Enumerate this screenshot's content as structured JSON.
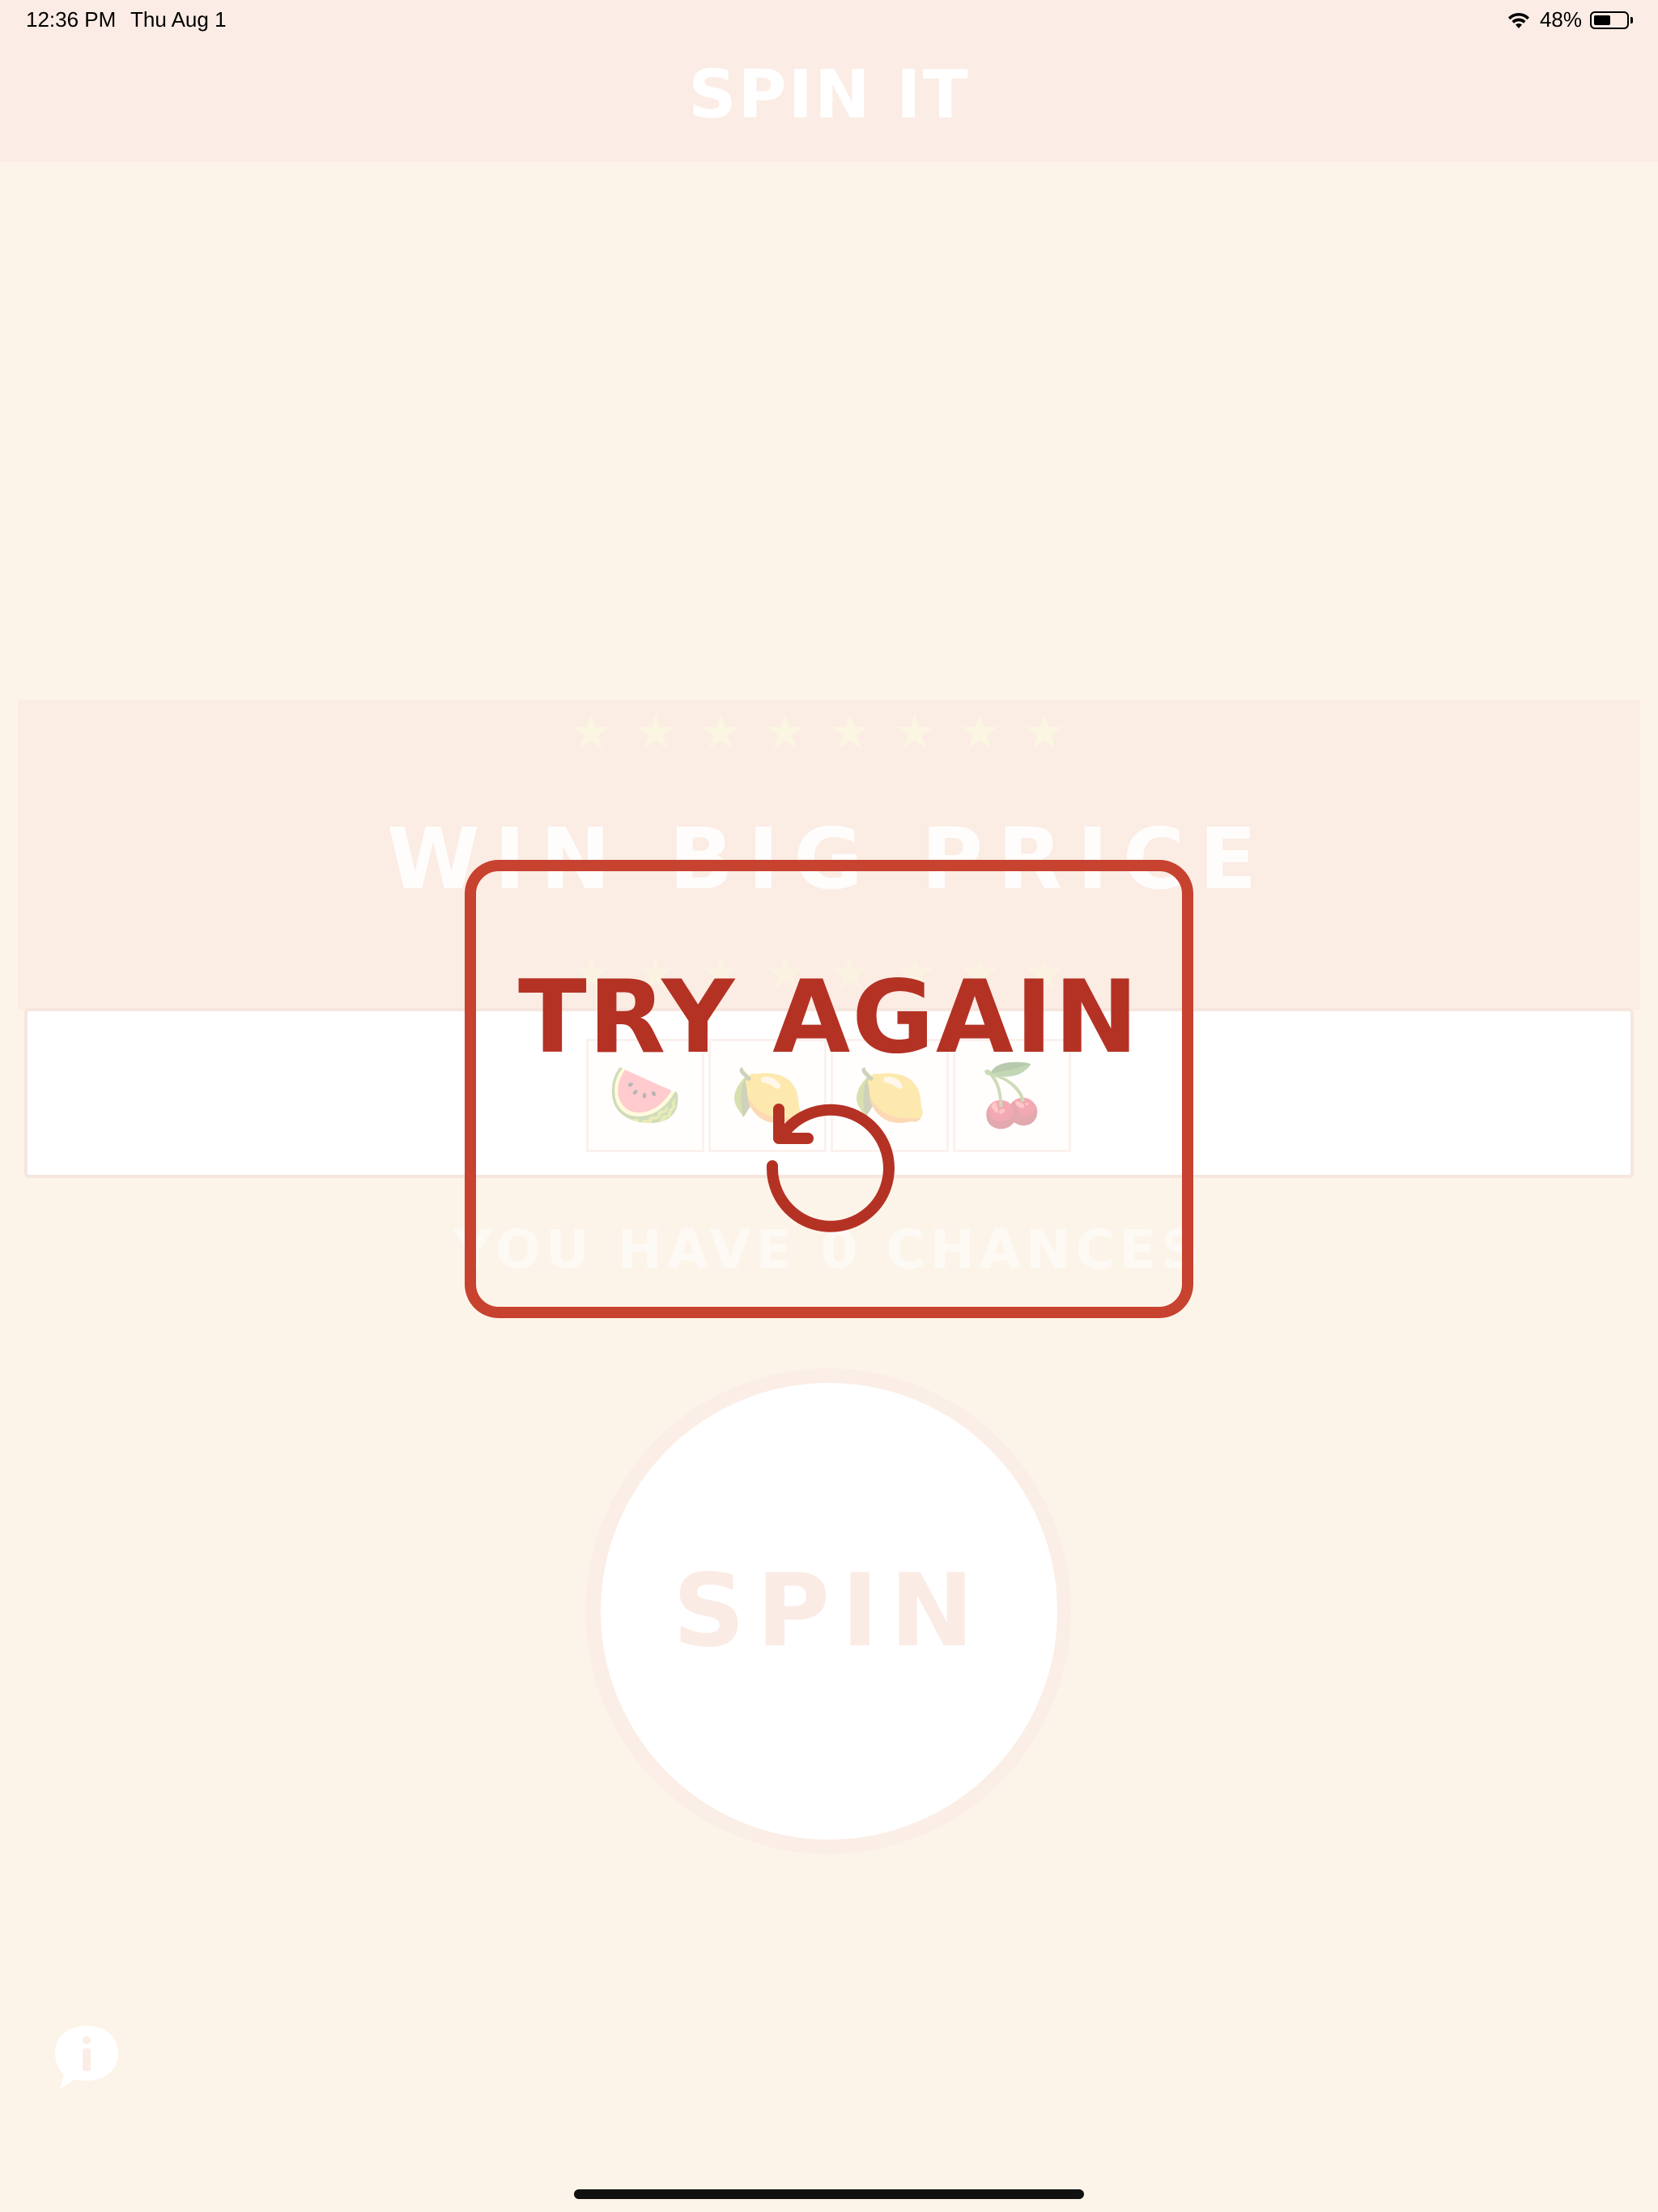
{
  "status_bar": {
    "time": "12:36 PM",
    "date": "Thu Aug 1",
    "battery": "48%",
    "battery_level": 0.48
  },
  "header": {
    "title": "SPIN IT"
  },
  "banner": {
    "stars": "★★★★★★★★",
    "title": "WIN BIG PRICE"
  },
  "reels": [
    {
      "icon": "🍉"
    },
    {
      "icon": "🍋"
    },
    {
      "icon": "🍋"
    },
    {
      "icon": "🍒"
    }
  ],
  "chances_text": "YOU HAVE 0 CHANCES",
  "spin_button": {
    "label": "SPIN"
  },
  "modal": {
    "title": "TRY AGAIN",
    "icon": "retry-icon"
  },
  "colors": {
    "accent": "#c7422f",
    "background": "#fdf4e9",
    "header": "#fbede5"
  }
}
